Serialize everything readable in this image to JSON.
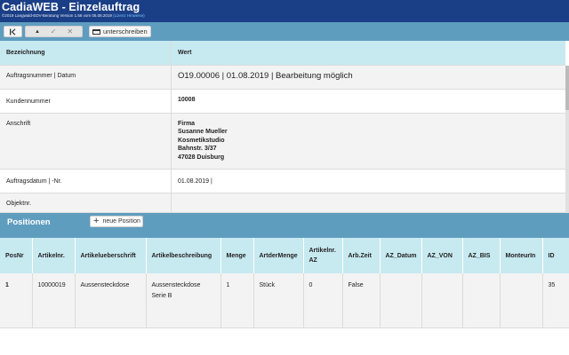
{
  "window": {
    "title": "CadiaWEB - Einzelauftrag",
    "subtitle": "©2019 Langwald-EDV-Beratung Version 1.56 vom 05.08.2019",
    "subtitle_link": "(Lizenz Hinweise)"
  },
  "toolbar": {
    "first_icon": "first-page-icon",
    "sort_icon": "sort-up-icon",
    "confirm_icon": "check-icon",
    "cancel_icon": "close-icon",
    "sign_label": "unterschreiben",
    "sign_icon": "card-icon"
  },
  "details": {
    "header_label": "Bezeichnung",
    "header_value": "Wert",
    "rows": [
      {
        "label": "Auftragsnummer | Datum",
        "value": "O19.00006 | 01.08.2019 | Bearbeitung möglich"
      },
      {
        "label": "Kundennummer",
        "value": "10008"
      },
      {
        "label": "Anschrift",
        "value_lines": [
          "Firma",
          "Susanne Mueller",
          "Kosmetikstudio",
          "Bahnstr. 3/37",
          "47028 Duisburg"
        ]
      },
      {
        "label": "Auftragsdatum | -Nr.",
        "value": "01.08.2019 |"
      },
      {
        "label": "Objektnr.",
        "value": ""
      }
    ]
  },
  "positions": {
    "title": "Positionen",
    "new_button_label": "neue Position",
    "columns": [
      "PosNr",
      "Artikelnr.",
      "Artikelueberschrift",
      "Artikelbeschreibung",
      "Menge",
      "ArtderMenge",
      "Artikelnr. AZ",
      "Arb.Zeit",
      "AZ_Datum",
      "AZ_VON",
      "AZ_BIS",
      "MonteurIn",
      "ID"
    ],
    "rows": [
      {
        "posnr": "1",
        "artikelnr": "10000019",
        "ueberschrift": "Aussensteckdose",
        "beschreibung": "Aussensteckdose Serie B",
        "menge": "1",
        "art": "Stück",
        "artaz": "0",
        "arbzeit": "False",
        "azdatum": "",
        "azvon": "",
        "azbis": "",
        "monteur": "",
        "id": "35"
      }
    ]
  },
  "colors": {
    "titlebar": "#1b3f86",
    "toolbar": "#5f9dbf",
    "header": "#c7e9f0"
  }
}
